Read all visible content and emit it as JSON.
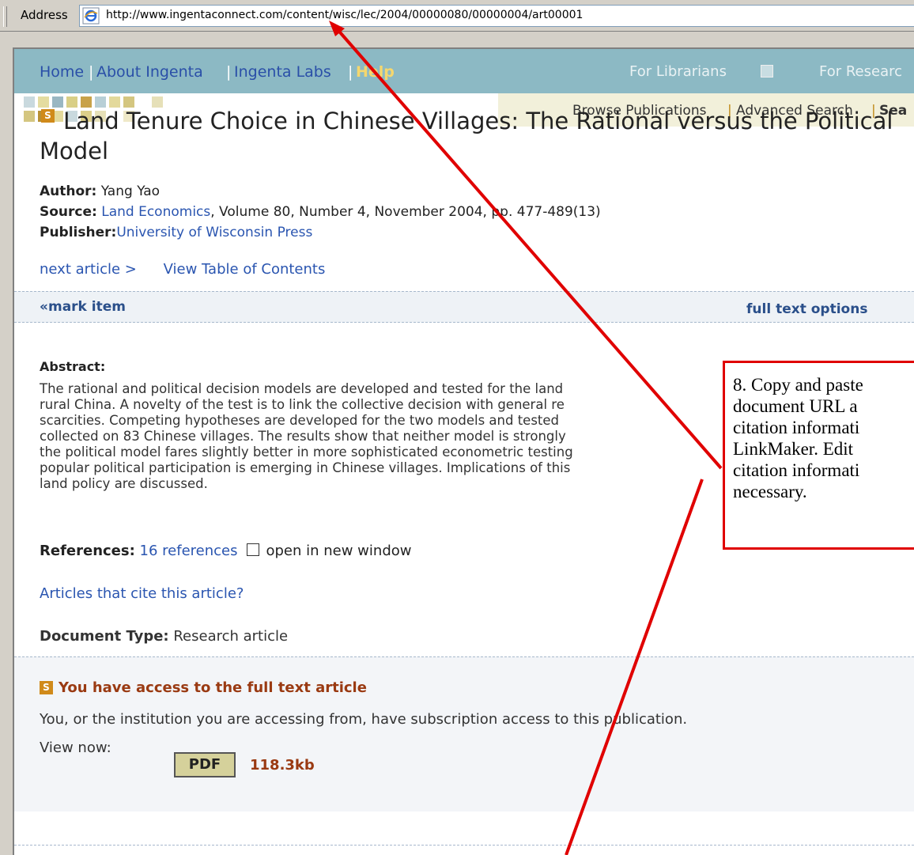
{
  "address_bar": {
    "label": "Address",
    "url": "http://www.ingentaconnect.com/content/wisc/lec/2004/00000080/00000004/art00001"
  },
  "top_nav": {
    "home": "Home",
    "about": "About Ingenta",
    "labs": "Ingenta Labs",
    "help": "Help",
    "for_librarians": "For Librarians",
    "for_researchers": "For Researc"
  },
  "sub_nav": {
    "browse": "Browse Publications",
    "advanced": "Advanced Search",
    "search": "Sea"
  },
  "article": {
    "title": "Land Tenure Choice in Chinese Villages: The Rational versus the Political Model",
    "author_label": "Author:",
    "author": "Yang Yao",
    "source_label": "Source:",
    "source_journal": "Land Economics",
    "source_rest": ", Volume 80, Number 4, November 2004, pp. 477-489(13)",
    "publisher_label": "Publisher:",
    "publisher": "University of Wisconsin Press",
    "next_article": "next article >",
    "view_toc": "View Table of Contents",
    "mark_item": "mark item",
    "full_text_options": "full text options",
    "abstract_label": "Abstract:",
    "abstract_lines": [
      "The rational and political decision models are developed and tested for the land",
      "rural China. A novelty of the test is to link the collective decision with general re",
      "scarcities. Competing hypotheses are developed for the two models and tested",
      "collected on 83 Chinese villages. The results show that neither model is strongly",
      "the political model fares slightly better in more sophisticated econometric testing",
      "popular political participation is emerging in Chinese villages. Implications of this",
      "land policy are discussed."
    ],
    "references_label": "References:",
    "references_link": "16 references",
    "open_new_window": "open in new window",
    "cite_link": "Articles that cite this article?",
    "doctype_label": "Document Type:",
    "doctype": "Research article"
  },
  "access": {
    "title": "You have access to the full text article",
    "text": "You, or the institution you are accessing from, have subscription access to this publication.",
    "view_now": "View now:",
    "pdf_label": "PDF",
    "pdf_size": "118.3kb"
  },
  "callout": {
    "lines": [
      "8. Copy and paste",
      "document URL a",
      "citation informati",
      "LinkMaker. Edit",
      "citation informati",
      "necessary."
    ]
  },
  "colors": {
    "nav_bar": "#8cb9c4",
    "link": "#2a55b0",
    "accent_orange": "#d08a1a",
    "access_title": "#9a3a12",
    "annotation_red": "#e00000"
  }
}
